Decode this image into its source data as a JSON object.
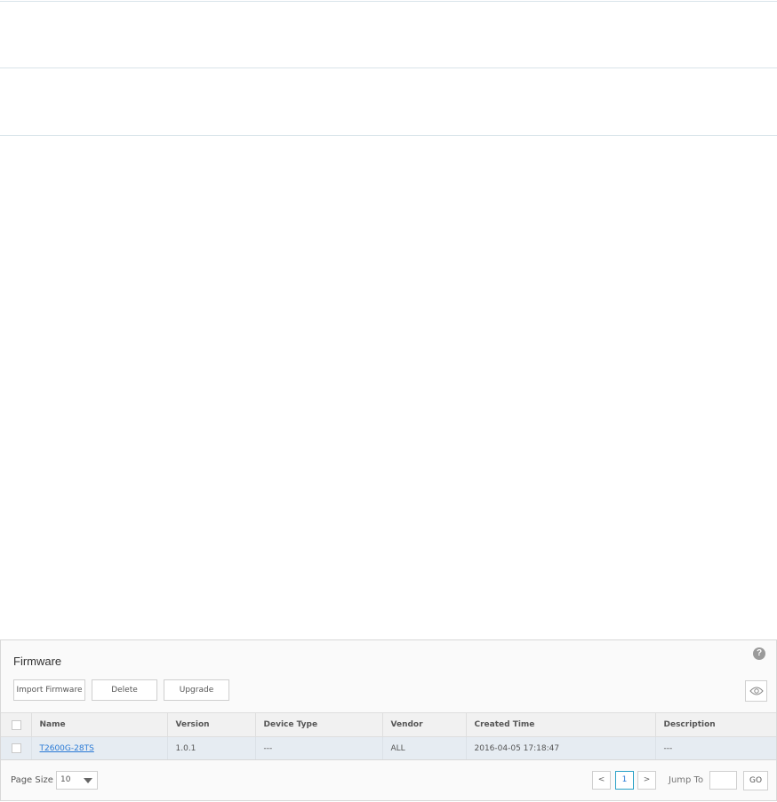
{
  "panel": {
    "title": "Firmware",
    "help_icon": "help-icon"
  },
  "toolbar": {
    "import_label": "Import Firmware",
    "delete_label": "Delete",
    "upgrade_label": "Upgrade",
    "column_toggle_icon": "eye-icon"
  },
  "table": {
    "columns": [
      "Name",
      "Version",
      "Device Type",
      "Vendor",
      "Created Time",
      "Description"
    ],
    "rows": [
      {
        "name": "T2600G-28TS",
        "version": "1.0.1",
        "device_type": "---",
        "vendor": "ALL",
        "created_time": "2016-04-05 17:18:47",
        "description": "---"
      }
    ]
  },
  "pagination": {
    "page_size_label": "Page Size",
    "page_size_value": "10",
    "prev_label": "<",
    "current_page": "1",
    "next_label": ">",
    "jump_label": "Jump To",
    "jump_value": "",
    "go_label": "GO"
  },
  "colors": {
    "accent": "#2aa1c7",
    "link": "#2a7ad6",
    "row_highlight": "#e6ecf2"
  }
}
